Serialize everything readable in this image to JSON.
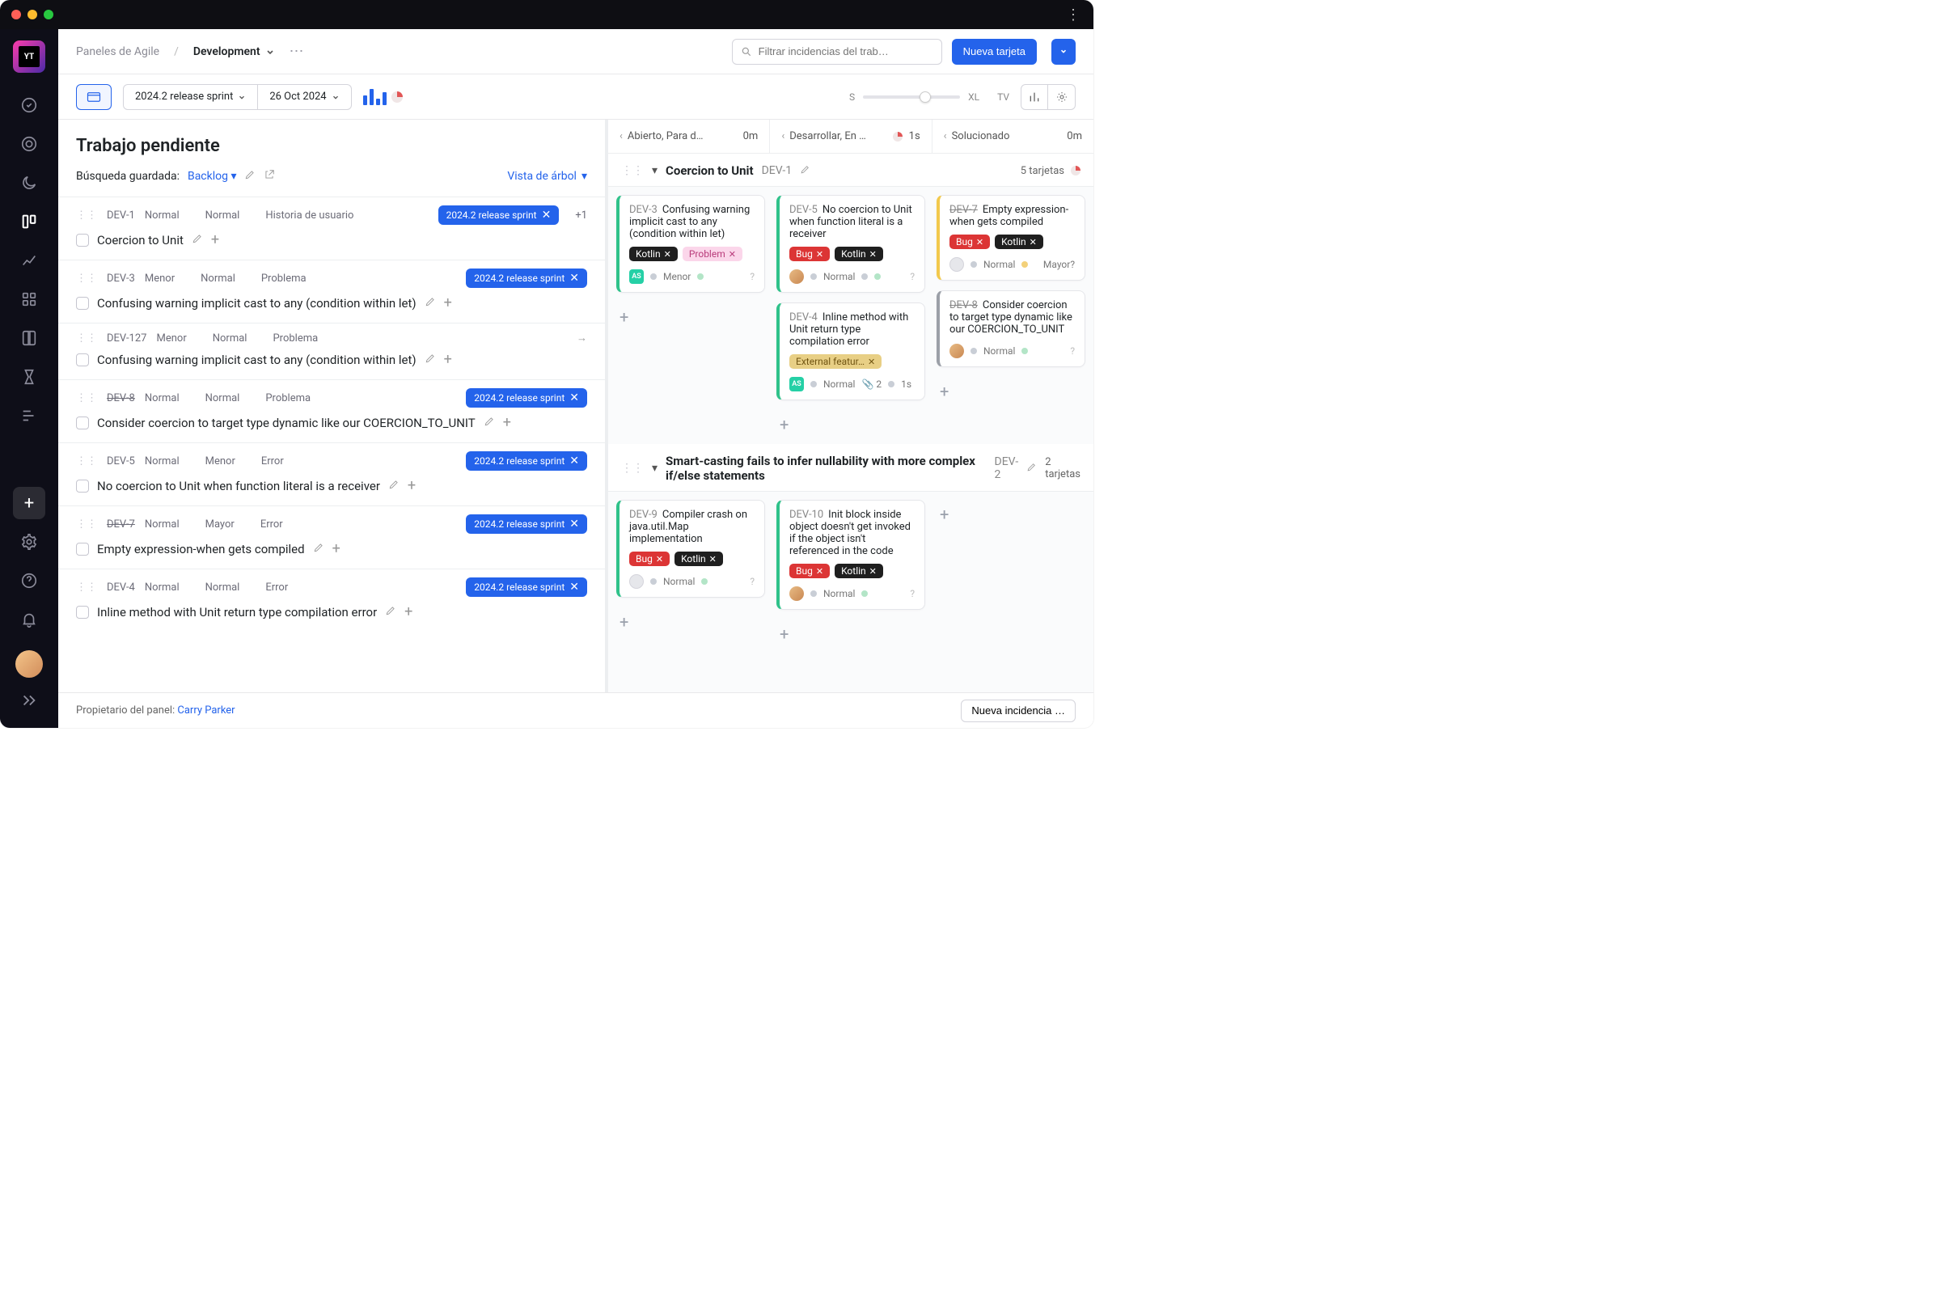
{
  "header": {
    "breadcrumb": "Paneles de Agile",
    "board": "Development",
    "search_placeholder": "Filtrar incidencias del trab…",
    "new_card": "Nueva tarjeta"
  },
  "toolbar": {
    "sprint": "2024.2 release sprint",
    "date": "26 Oct 2024",
    "size_s": "S",
    "size_xl": "XL",
    "tv": "TV"
  },
  "backlog": {
    "title": "Trabajo pendiente",
    "saved_search_label": "Búsqueda guardada:",
    "saved_search_name": "Backlog",
    "tree_view": "Vista de árbol",
    "tag": "2024.2 release sprint",
    "plusone": "+1",
    "rows": [
      {
        "id": "DEV-1",
        "chips": [
          "Normal",
          "Normal",
          "Historia de usuario"
        ],
        "has_tag": true,
        "plusone": true,
        "strike": false,
        "title": "Coercion to Unit",
        "arrow": false
      },
      {
        "id": "DEV-3",
        "chips": [
          "Menor",
          "Normal",
          "Problema"
        ],
        "has_tag": true,
        "plusone": false,
        "strike": false,
        "title": "Confusing warning implicit cast to any (condition within let)",
        "arrow": false
      },
      {
        "id": "DEV-127",
        "chips": [
          "Menor",
          "Normal",
          "Problema"
        ],
        "has_tag": false,
        "plusone": false,
        "strike": false,
        "title": "Confusing warning implicit cast to any (condition within let)",
        "arrow": true
      },
      {
        "id": "DEV-8",
        "chips": [
          "Normal",
          "Normal",
          "Problema"
        ],
        "has_tag": true,
        "plusone": false,
        "strike": true,
        "title": "Consider coercion to target type dynamic like our COERCION_TO_UNIT",
        "arrow": false
      },
      {
        "id": "DEV-5",
        "chips": [
          "Normal",
          "Menor",
          "Error"
        ],
        "has_tag": true,
        "plusone": false,
        "strike": false,
        "title": "No coercion to Unit when function literal is a receiver",
        "arrow": false
      },
      {
        "id": "DEV-7",
        "chips": [
          "Normal",
          "Mayor",
          "Error"
        ],
        "has_tag": true,
        "plusone": false,
        "strike": true,
        "title": "Empty expression-when gets compiled",
        "arrow": false
      },
      {
        "id": "DEV-4",
        "chips": [
          "Normal",
          "Normal",
          "Error"
        ],
        "has_tag": true,
        "plusone": false,
        "strike": false,
        "title": "Inline method with Unit return type compilation error",
        "arrow": false
      }
    ]
  },
  "columns": [
    {
      "name": "Abierto, Para d…",
      "meta": "0m"
    },
    {
      "name": "Desarrollar, En …",
      "meta": "1s",
      "pie": true
    },
    {
      "name": "Solucionado",
      "meta": "0m"
    }
  ],
  "swimlanes": [
    {
      "title": "Coercion to Unit",
      "id": "DEV-1",
      "count": "5 tarjetas",
      "pie": true,
      "cols": [
        [
          {
            "accent": "green",
            "id": "DEV-3",
            "title": "Confusing warning implicit cast to any (condition within let)",
            "tags": [
              [
                "Kotlin",
                "t-kotlin"
              ],
              [
                "Problem",
                "t-problem"
              ]
            ],
            "foot": {
              "av": "sq",
              "label": "Menor",
              "bullets": [
                "g"
              ],
              "q": true
            }
          }
        ],
        [
          {
            "accent": "green",
            "id": "DEV-5",
            "title": "No coercion to Unit when function literal is a receiver",
            "tags": [
              [
                "Bug",
                "t-bug"
              ],
              [
                "Kotlin",
                "t-kotlin"
              ]
            ],
            "foot": {
              "av": "rd",
              "label": "Normal",
              "bullets": [
                "",
                "g"
              ],
              "q": true
            }
          },
          {
            "accent": "green",
            "id": "DEV-4",
            "title": "Inline method with Unit return type compilation error",
            "tags": [
              [
                "External featur…",
                "t-feat"
              ]
            ],
            "foot": {
              "av": "sq",
              "label": "Normal",
              "bullets": [],
              "attach": "2",
              "time": "1s"
            }
          }
        ],
        [
          {
            "accent": "yellow",
            "strike": true,
            "id": "DEV-7",
            "title": "Empty expression-when gets compiled",
            "tags": [
              [
                "Bug",
                "t-bug"
              ],
              [
                "Kotlin",
                "t-kotlin"
              ]
            ],
            "foot": {
              "av": "gh",
              "label": "Normal",
              "bullets": [
                "y"
              ],
              "right": "Mayor?"
            }
          },
          {
            "accent": "",
            "strike": true,
            "id": "DEV-8",
            "title": "Consider coercion to target type dynamic like our COERCION_TO_UNIT",
            "tags": [],
            "foot": {
              "av": "rd",
              "label": "Normal",
              "bullets": [
                "g"
              ],
              "q": true
            }
          }
        ]
      ]
    },
    {
      "title": "Smart-casting fails to infer nullability with more complex if/else statements",
      "id": "DEV-2",
      "count": "2 tarjetas",
      "cols": [
        [
          {
            "accent": "green",
            "id": "DEV-9",
            "title": "Compiler crash on java.util.Map implementation",
            "tags": [
              [
                "Bug",
                "t-bug"
              ],
              [
                "Kotlin",
                "t-kotlin"
              ]
            ],
            "foot": {
              "av": "gh",
              "label": "Normal",
              "bullets": [
                "g"
              ],
              "q": true
            }
          }
        ],
        [
          {
            "accent": "green",
            "id": "DEV-10",
            "title": "Init block inside object doesn't get invoked if the object isn't referenced in the code",
            "tags": [
              [
                "Bug",
                "t-bug"
              ],
              [
                "Kotlin",
                "t-kotlin"
              ]
            ],
            "foot": {
              "av": "rd",
              "label": "Normal",
              "bullets": [
                "g"
              ],
              "q": true
            }
          }
        ],
        []
      ]
    }
  ],
  "footer": {
    "owner_label": "Propietario del panel:",
    "owner": "Carry Parker",
    "new_issue": "Nueva incidencia …"
  }
}
